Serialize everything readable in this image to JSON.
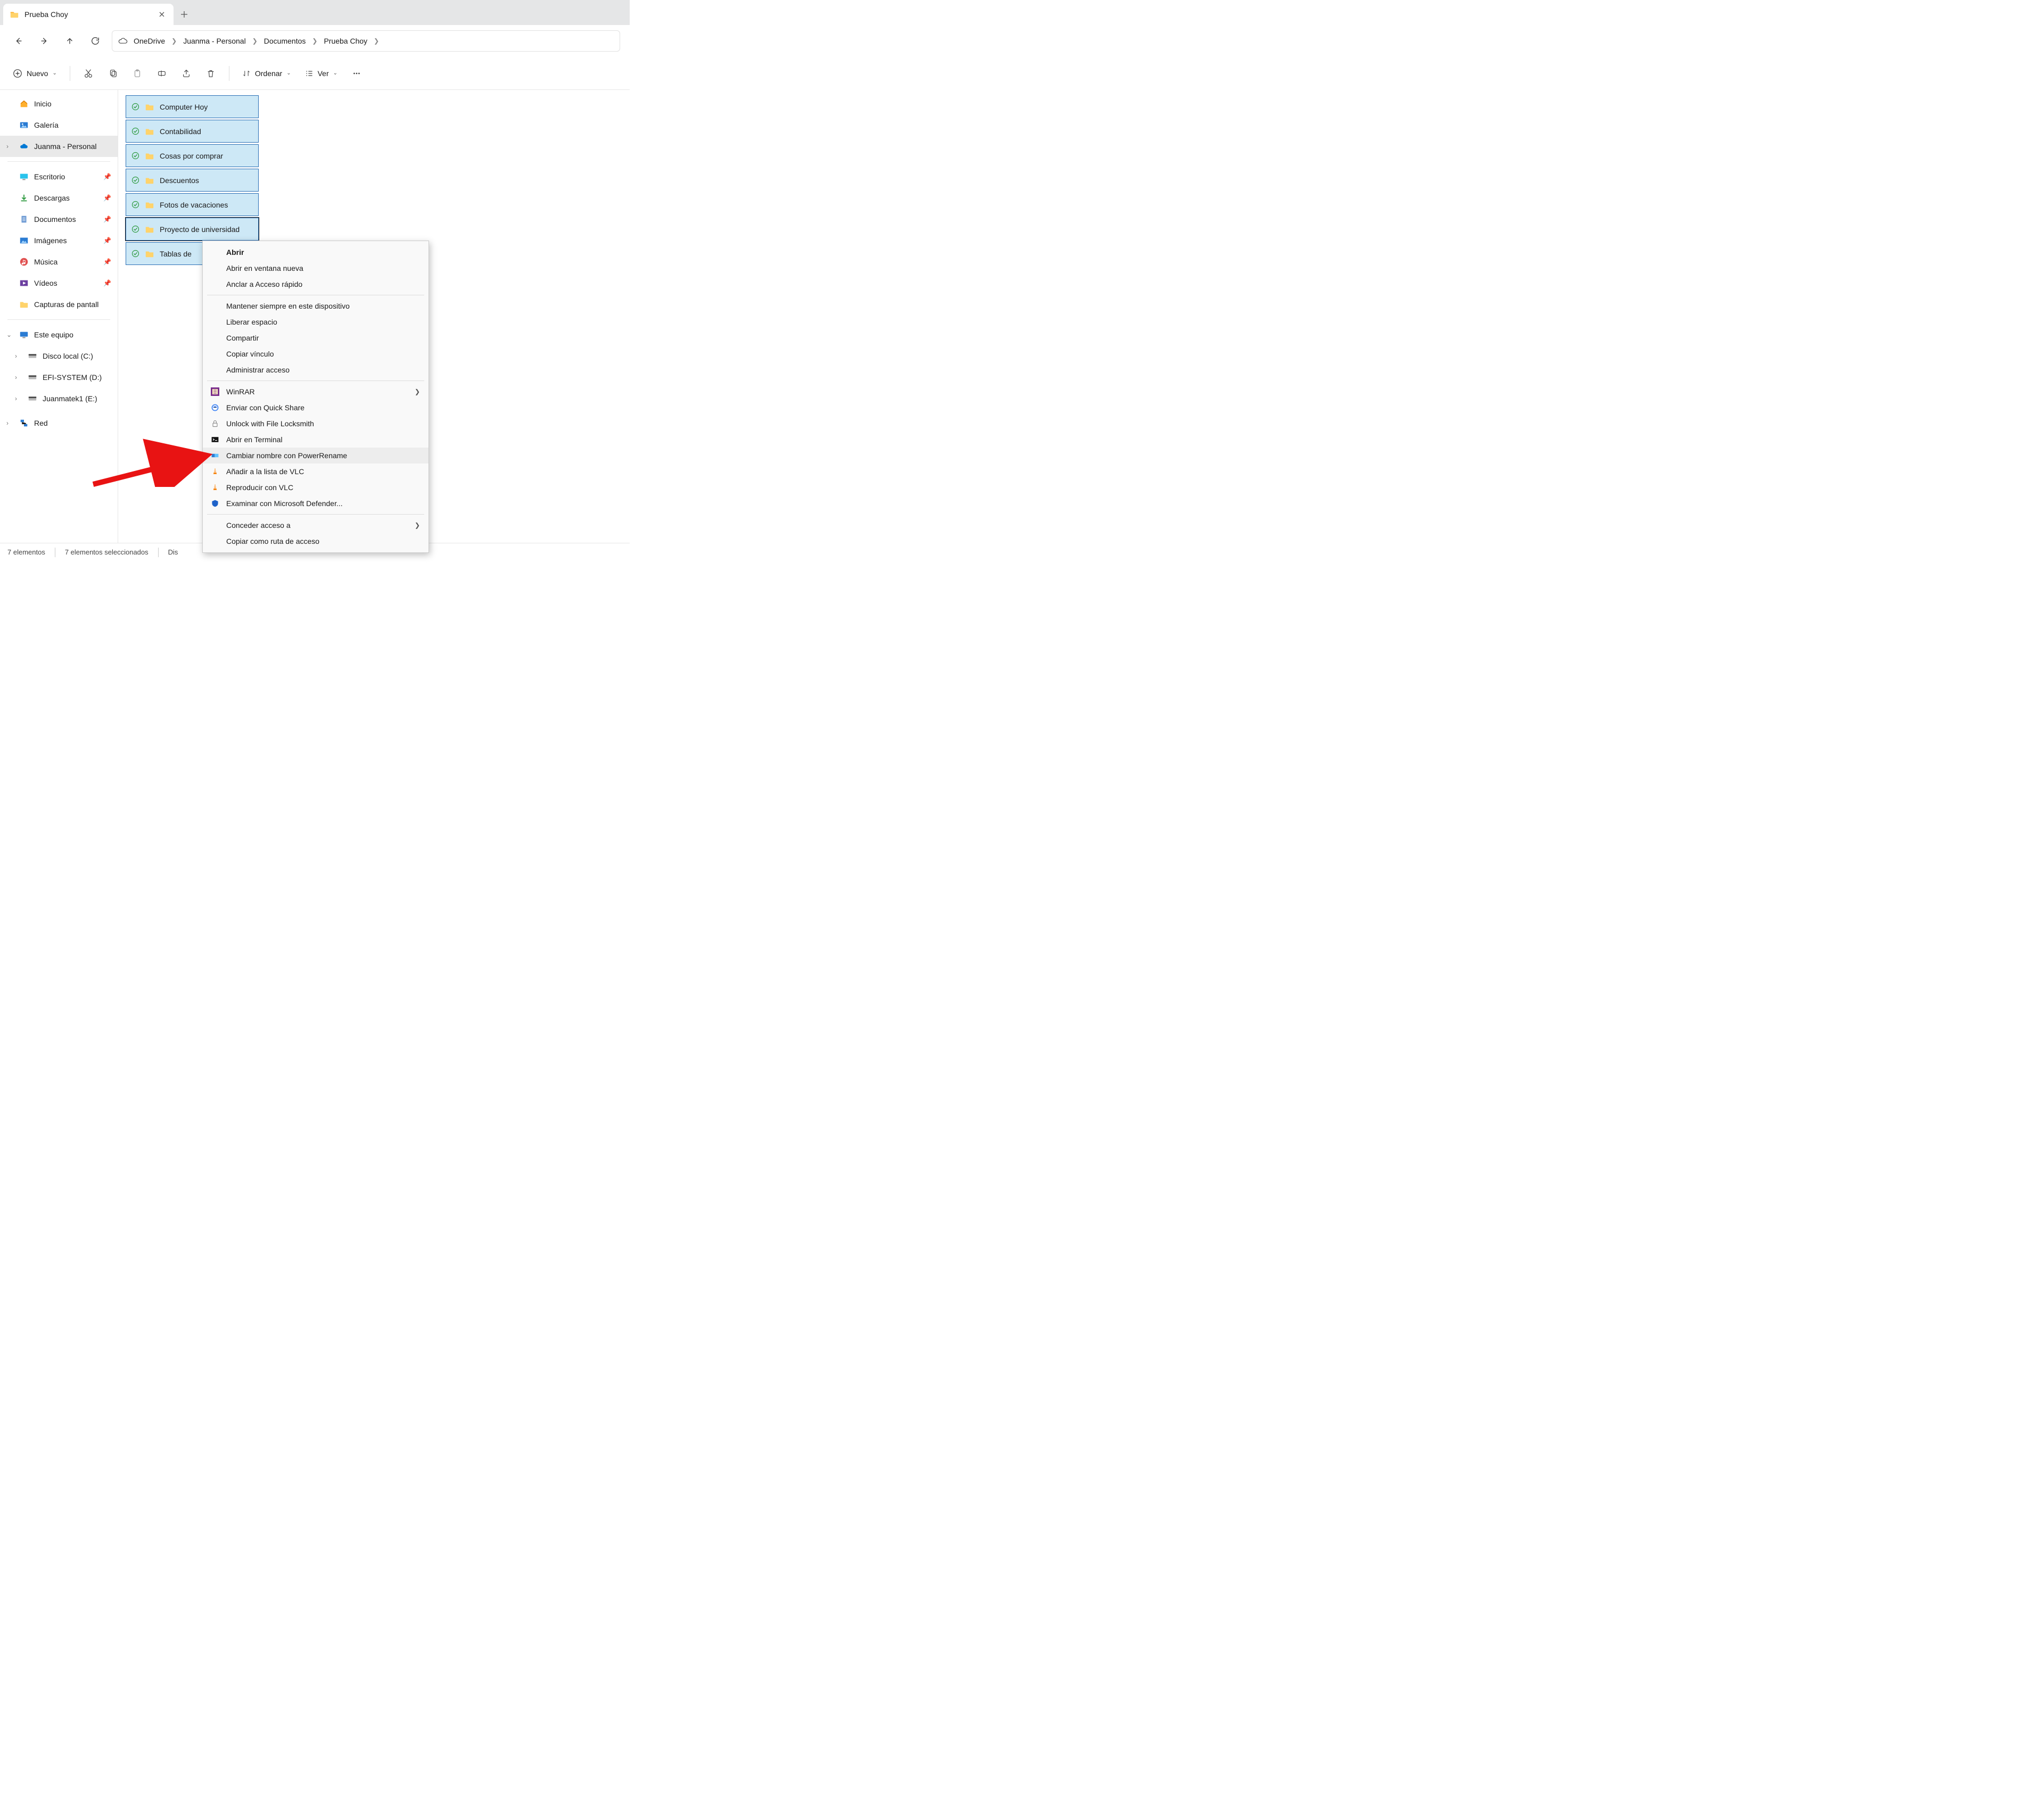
{
  "tab": {
    "title": "Prueba Choy"
  },
  "breadcrumb": [
    "OneDrive",
    "Juanma - Personal",
    "Documentos",
    "Prueba Choy"
  ],
  "toolbar": {
    "new": "Nuevo",
    "sort": "Ordenar",
    "view": "Ver"
  },
  "sidebar": {
    "top": [
      {
        "label": "Inicio",
        "icon": "home"
      },
      {
        "label": "Galería",
        "icon": "gallery"
      },
      {
        "label": "Juanma - Personal",
        "icon": "onedrive",
        "active": true,
        "expandable": true
      }
    ],
    "quick": [
      {
        "label": "Escritorio",
        "icon": "desktop",
        "pin": true
      },
      {
        "label": "Descargas",
        "icon": "download",
        "pin": true
      },
      {
        "label": "Documentos",
        "icon": "document",
        "pin": true
      },
      {
        "label": "Imágenes",
        "icon": "image",
        "pin": true
      },
      {
        "label": "Música",
        "icon": "music",
        "pin": true
      },
      {
        "label": "Vídeos",
        "icon": "video",
        "pin": true
      },
      {
        "label": "Capturas de pantall",
        "icon": "folder",
        "pin": false
      }
    ],
    "thispc": {
      "label": "Este equipo"
    },
    "drives": [
      {
        "label": "Disco local (C:)"
      },
      {
        "label": "EFI-SYSTEM (D:)"
      },
      {
        "label": "Juanmatek1 (E:)"
      }
    ],
    "network": {
      "label": "Red"
    }
  },
  "folders": [
    "Computer Hoy",
    "Contabilidad",
    "Cosas por comprar",
    "Descuentos",
    "Fotos de vacaciones",
    "Proyecto de universidad",
    "Tablas de"
  ],
  "contextmenu": {
    "g1": [
      "Abrir",
      "Abrir en ventana nueva",
      "Anclar a Acceso rápido"
    ],
    "g2": [
      "Mantener siempre en este dispositivo",
      "Liberar espacio",
      "Compartir",
      "Copiar vínculo",
      "Administrar acceso"
    ],
    "g3": [
      {
        "label": "WinRAR",
        "icon": "winrar",
        "sub": true
      },
      {
        "label": "Enviar con Quick Share",
        "icon": "quickshare"
      },
      {
        "label": "Unlock with File Locksmith",
        "icon": "lock"
      },
      {
        "label": "Abrir en Terminal",
        "icon": "terminal"
      },
      {
        "label": "Cambiar nombre con PowerRename",
        "icon": "powerrename",
        "hover": true
      },
      {
        "label": "Añadir a la lista de VLC",
        "icon": "vlc"
      },
      {
        "label": "Reproducir con VLC",
        "icon": "vlc"
      },
      {
        "label": "Examinar con Microsoft Defender...",
        "icon": "defender"
      }
    ],
    "g4": [
      {
        "label": "Conceder acceso a",
        "sub": true
      },
      {
        "label": "Copiar como ruta de acceso"
      }
    ]
  },
  "statusbar": {
    "count": "7 elementos",
    "selected": "7 elementos seleccionados",
    "extra": "Dis"
  }
}
